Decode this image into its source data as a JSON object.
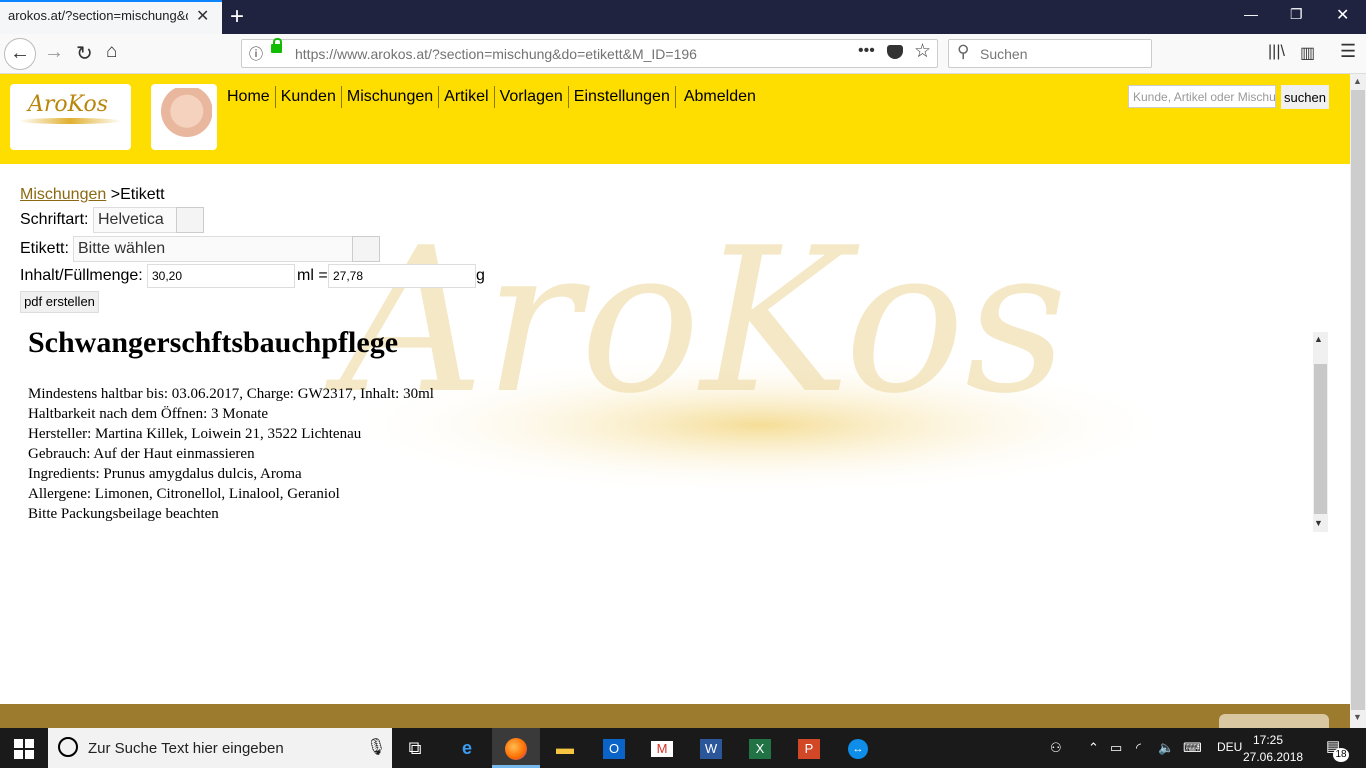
{
  "browser": {
    "tab_title": "arokos.at/?section=mischung&do=",
    "url": "https://www.arokos.at/?section=mischung&do=etikett&M_ID=196",
    "search_placeholder": "Suchen"
  },
  "header": {
    "logo_text": "AroKos",
    "nav": [
      "Home",
      "Kunden",
      "Mischungen",
      "Artikel",
      "Vorlagen",
      "Einstellungen",
      "Abmelden"
    ],
    "search_placeholder": "Kunde, Artikel oder Mischung",
    "search_button": "suchen"
  },
  "breadcrumb": {
    "link": "Mischungen",
    "current": ">Etikett"
  },
  "form": {
    "font_label": "Schriftart:",
    "font_value": "Helvetica",
    "label_label": "Etikett:",
    "label_value": "Bitte wählen",
    "content_label": "Inhalt/Füllmenge:",
    "ml_value": "30,20",
    "ml_unit": "ml =",
    "g_value": "27,78",
    "g_unit": "g",
    "pdf_button": "pdf erstellen"
  },
  "preview": {
    "title": "Schwangerschftsbauchpflege",
    "lines": [
      "Mindestens haltbar bis: 03.06.2017, Charge: GW2317, Inhalt: 30ml",
      "Haltbarkeit nach dem Öffnen: 3 Monate",
      "Hersteller: Martina Killek, Loiwein 21, 3522 Lichtenau",
      "Gebrauch: Auf der Haut einmassieren",
      "Ingredients: Prunus amygdalus dulcis, Aroma",
      "Allergene: Limonen, Citronellol, Linalool, Geraniol",
      "Bitte Packungsbeilage beachten"
    ]
  },
  "watermark_text": "AroKos",
  "taskbar": {
    "search_text": "Zur Suche Text hier eingeben",
    "language": "DEU",
    "time": "17:25",
    "date": "27.06.2018",
    "notifications": "18"
  },
  "colors": {
    "header": "#fedd00",
    "footer": "#9c7a2e",
    "link": "#8b6914"
  }
}
